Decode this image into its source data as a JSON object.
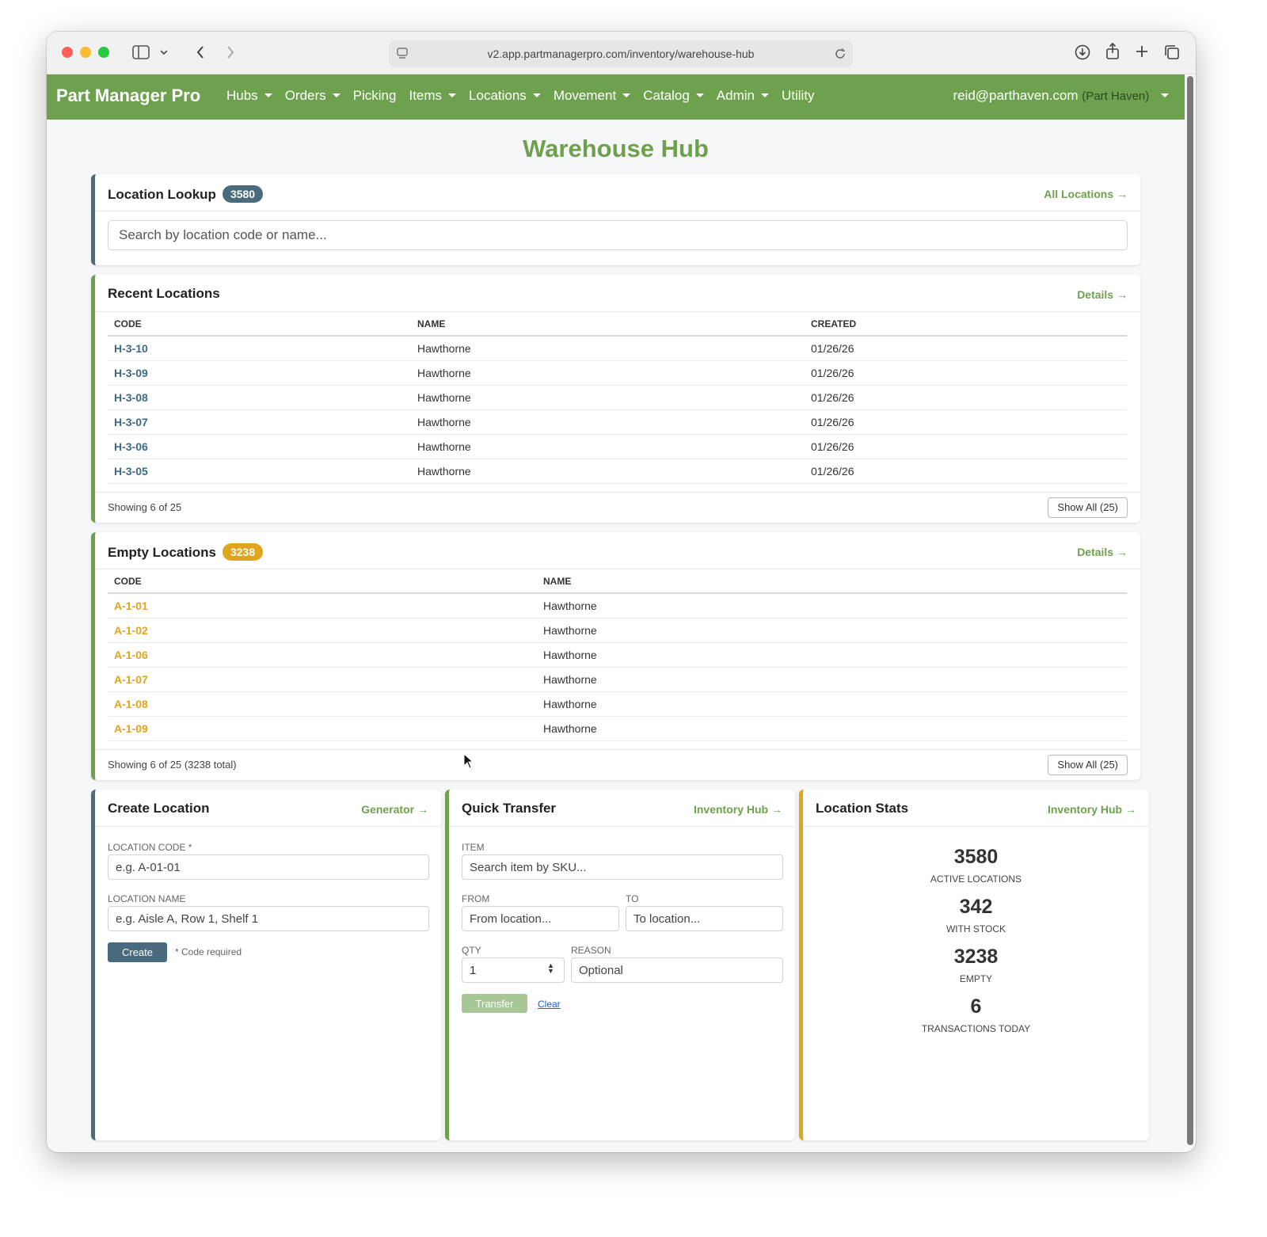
{
  "browser": {
    "url": "v2.app.partmanagerpro.com/inventory/warehouse-hub"
  },
  "navbar": {
    "brand": "Part Manager Pro",
    "items": [
      {
        "label": "Hubs",
        "dropdown": true
      },
      {
        "label": "Orders",
        "dropdown": true
      },
      {
        "label": "Picking",
        "dropdown": false
      },
      {
        "label": "Items",
        "dropdown": true
      },
      {
        "label": "Locations",
        "dropdown": true
      },
      {
        "label": "Movement",
        "dropdown": true
      },
      {
        "label": "Catalog",
        "dropdown": true
      },
      {
        "label": "Admin",
        "dropdown": true
      },
      {
        "label": "Utility",
        "dropdown": false
      }
    ],
    "user_email": "reid@parthaven.com",
    "user_org": "(Part Haven)"
  },
  "page": {
    "title": "Warehouse Hub"
  },
  "location_lookup": {
    "title": "Location Lookup",
    "badge": "3580",
    "link": "All Locations →",
    "placeholder": "Search by location code or name..."
  },
  "recent_locations": {
    "title": "Recent Locations",
    "link": "Details →",
    "columns": [
      "CODE",
      "NAME",
      "CREATED"
    ],
    "rows": [
      {
        "code": "H-3-10",
        "name": "Hawthorne",
        "created": "01/26/26"
      },
      {
        "code": "H-3-09",
        "name": "Hawthorne",
        "created": "01/26/26"
      },
      {
        "code": "H-3-08",
        "name": "Hawthorne",
        "created": "01/26/26"
      },
      {
        "code": "H-3-07",
        "name": "Hawthorne",
        "created": "01/26/26"
      },
      {
        "code": "H-3-06",
        "name": "Hawthorne",
        "created": "01/26/26"
      },
      {
        "code": "H-3-05",
        "name": "Hawthorne",
        "created": "01/26/26"
      }
    ],
    "showing": "Showing 6 of 25",
    "show_all": "Show All (25)"
  },
  "empty_locations": {
    "title": "Empty Locations",
    "badge": "3238",
    "link": "Details →",
    "columns": [
      "CODE",
      "NAME"
    ],
    "rows": [
      {
        "code": "A-1-01",
        "name": "Hawthorne"
      },
      {
        "code": "A-1-02",
        "name": "Hawthorne"
      },
      {
        "code": "A-1-06",
        "name": "Hawthorne"
      },
      {
        "code": "A-1-07",
        "name": "Hawthorne"
      },
      {
        "code": "A-1-08",
        "name": "Hawthorne"
      },
      {
        "code": "A-1-09",
        "name": "Hawthorne"
      }
    ],
    "showing": "Showing 6 of 25 (3238 total)",
    "show_all": "Show All (25)"
  },
  "create_location": {
    "title": "Create Location",
    "link": "Generator →",
    "code_label": "LOCATION CODE *",
    "code_placeholder": "e.g. A-01-01",
    "name_label": "LOCATION NAME",
    "name_placeholder": "e.g. Aisle A, Row 1, Shelf 1",
    "button": "Create",
    "hint": "* Code required"
  },
  "quick_transfer": {
    "title": "Quick Transfer",
    "link": "Inventory Hub →",
    "item_label": "ITEM",
    "item_placeholder": "Search item by SKU...",
    "from_label": "FROM",
    "from_placeholder": "From location...",
    "to_label": "TO",
    "to_placeholder": "To location...",
    "qty_label": "QTY",
    "qty_value": "1",
    "reason_label": "REASON",
    "reason_placeholder": "Optional",
    "button": "Transfer",
    "clear": "Clear"
  },
  "location_stats": {
    "title": "Location Stats",
    "link": "Inventory Hub →",
    "stats": [
      {
        "value": "3580",
        "label": "ACTIVE LOCATIONS"
      },
      {
        "value": "342",
        "label": "WITH STOCK"
      },
      {
        "value": "3238",
        "label": "EMPTY"
      },
      {
        "value": "6",
        "label": "TRANSACTIONS TODAY"
      }
    ]
  },
  "colors": {
    "brand_green": "#6ea14e",
    "slate_blue": "#4a6b7d",
    "amber": "#e0a51c"
  }
}
